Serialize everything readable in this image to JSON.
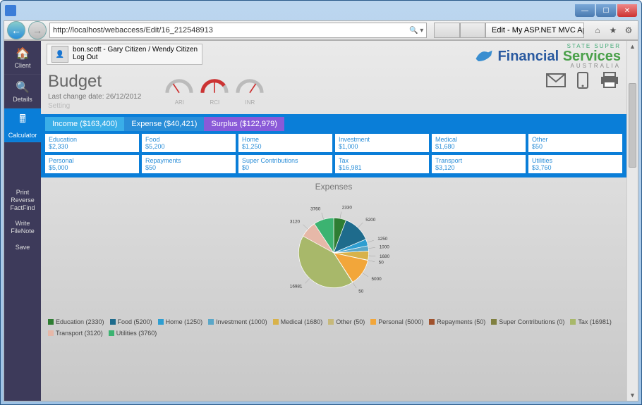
{
  "window": {
    "title": "Edit - My ASP.NET MVC Ap..."
  },
  "browser": {
    "url": "http://localhost/webaccess/Edit/16_212548913",
    "search_hint": "",
    "tabs": [
      {
        "label": "",
        "active": false
      },
      {
        "label": "",
        "active": false
      },
      {
        "label": "Edit - My ASP.NET MVC Ap...",
        "active": true
      }
    ]
  },
  "user": {
    "line1": "bon.scott - Gary Citizen / Wendy Citizen",
    "logout": "Log Out"
  },
  "brand": {
    "top": "STATE SUPER",
    "main1": "Financial",
    "main2": "Services",
    "bottom": "AUSTRALIA"
  },
  "nav": {
    "items": [
      {
        "label": "Client",
        "icon": "home"
      },
      {
        "label": "Details",
        "icon": "search"
      },
      {
        "label": "Calculator",
        "icon": "calc"
      }
    ],
    "actions": [
      {
        "label": "Print Reverse FactFind"
      },
      {
        "label": "Write FileNote"
      },
      {
        "label": "Save"
      }
    ]
  },
  "budget": {
    "title": "Budget",
    "lastchange_label": "Last change date:",
    "lastchange_value": "26/12/2012",
    "setting": "Setting",
    "gauges": [
      {
        "label": "ARI"
      },
      {
        "label": "RCI"
      },
      {
        "label": "INR"
      }
    ]
  },
  "summary": {
    "income": {
      "label": "Income",
      "value": "$163,400"
    },
    "expense": {
      "label": "Expense",
      "value": "$40,421"
    },
    "surplus": {
      "label": "Surplus",
      "value": "$122,979"
    }
  },
  "cards": [
    {
      "name": "Education",
      "value": "$2,330"
    },
    {
      "name": "Food",
      "value": "$5,200"
    },
    {
      "name": "Home",
      "value": "$1,250"
    },
    {
      "name": "Investment",
      "value": "$1,000"
    },
    {
      "name": "Medical",
      "value": "$1,680"
    },
    {
      "name": "Other",
      "value": "$50"
    },
    {
      "name": "Personal",
      "value": "$5,000"
    },
    {
      "name": "Repayments",
      "value": "$50"
    },
    {
      "name": "Super Contributions",
      "value": "$0"
    },
    {
      "name": "Tax",
      "value": "$16,981"
    },
    {
      "name": "Transport",
      "value": "$3,120"
    },
    {
      "name": "Utilities",
      "value": "$3,760"
    }
  ],
  "chart_data": {
    "type": "pie",
    "title": "Expenses",
    "series": [
      {
        "name": "Education",
        "value": 2330,
        "color": "#2e7d32"
      },
      {
        "name": "Food",
        "value": 5200,
        "color": "#1e6b8c"
      },
      {
        "name": "Home",
        "value": 1250,
        "color": "#2e9ed1"
      },
      {
        "name": "Investment",
        "value": 1000,
        "color": "#5aa7c8"
      },
      {
        "name": "Medical",
        "value": 1680,
        "color": "#d8b24a"
      },
      {
        "name": "Other",
        "value": 50,
        "color": "#c7b97a"
      },
      {
        "name": "Personal",
        "value": 5000,
        "color": "#f2a63a"
      },
      {
        "name": "Repayments",
        "value": 50,
        "color": "#a0522d"
      },
      {
        "name": "Super Contributions",
        "value": 0,
        "color": "#808040"
      },
      {
        "name": "Tax",
        "value": 16981,
        "color": "#a8b86a"
      },
      {
        "name": "Transport",
        "value": 3120,
        "color": "#e6b8a8"
      },
      {
        "name": "Utilities",
        "value": 3760,
        "color": "#3cb371"
      }
    ]
  }
}
